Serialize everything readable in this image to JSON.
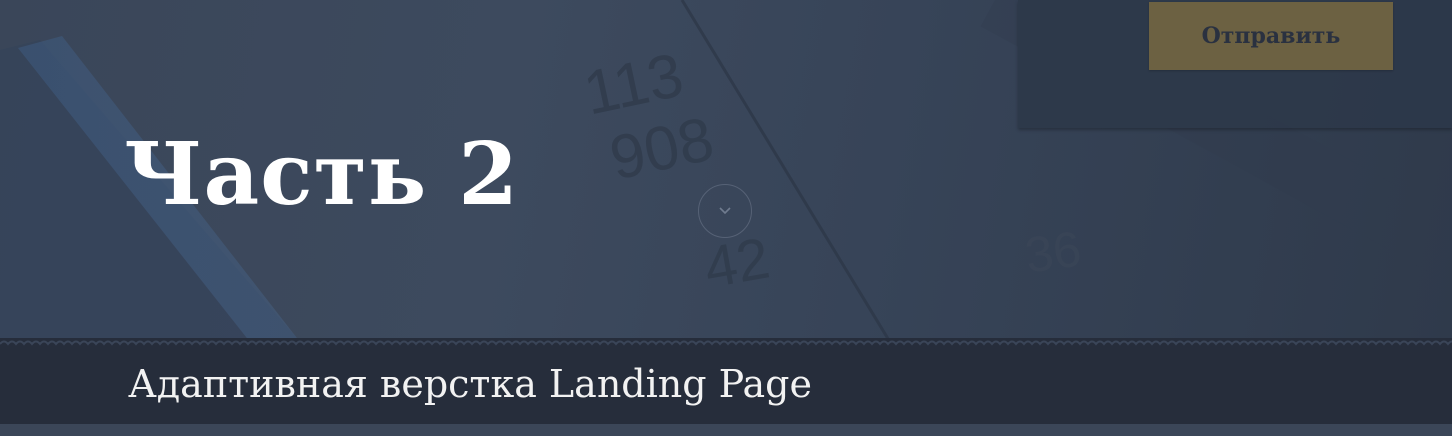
{
  "hero": {
    "title": "Часть 2",
    "bg_numbers": [
      "113",
      "908",
      "36",
      "42"
    ]
  },
  "form": {
    "submit_label": "Отправить"
  },
  "scroll_down": {
    "icon": "chevron-down-icon"
  },
  "caption": {
    "text": "Адаптивная верстка Landing Page"
  },
  "colors": {
    "hero_overlay": "#3a4659",
    "button_accent": "#6c6142",
    "caption_band": "#262d3b",
    "text_light": "#ffffff"
  }
}
